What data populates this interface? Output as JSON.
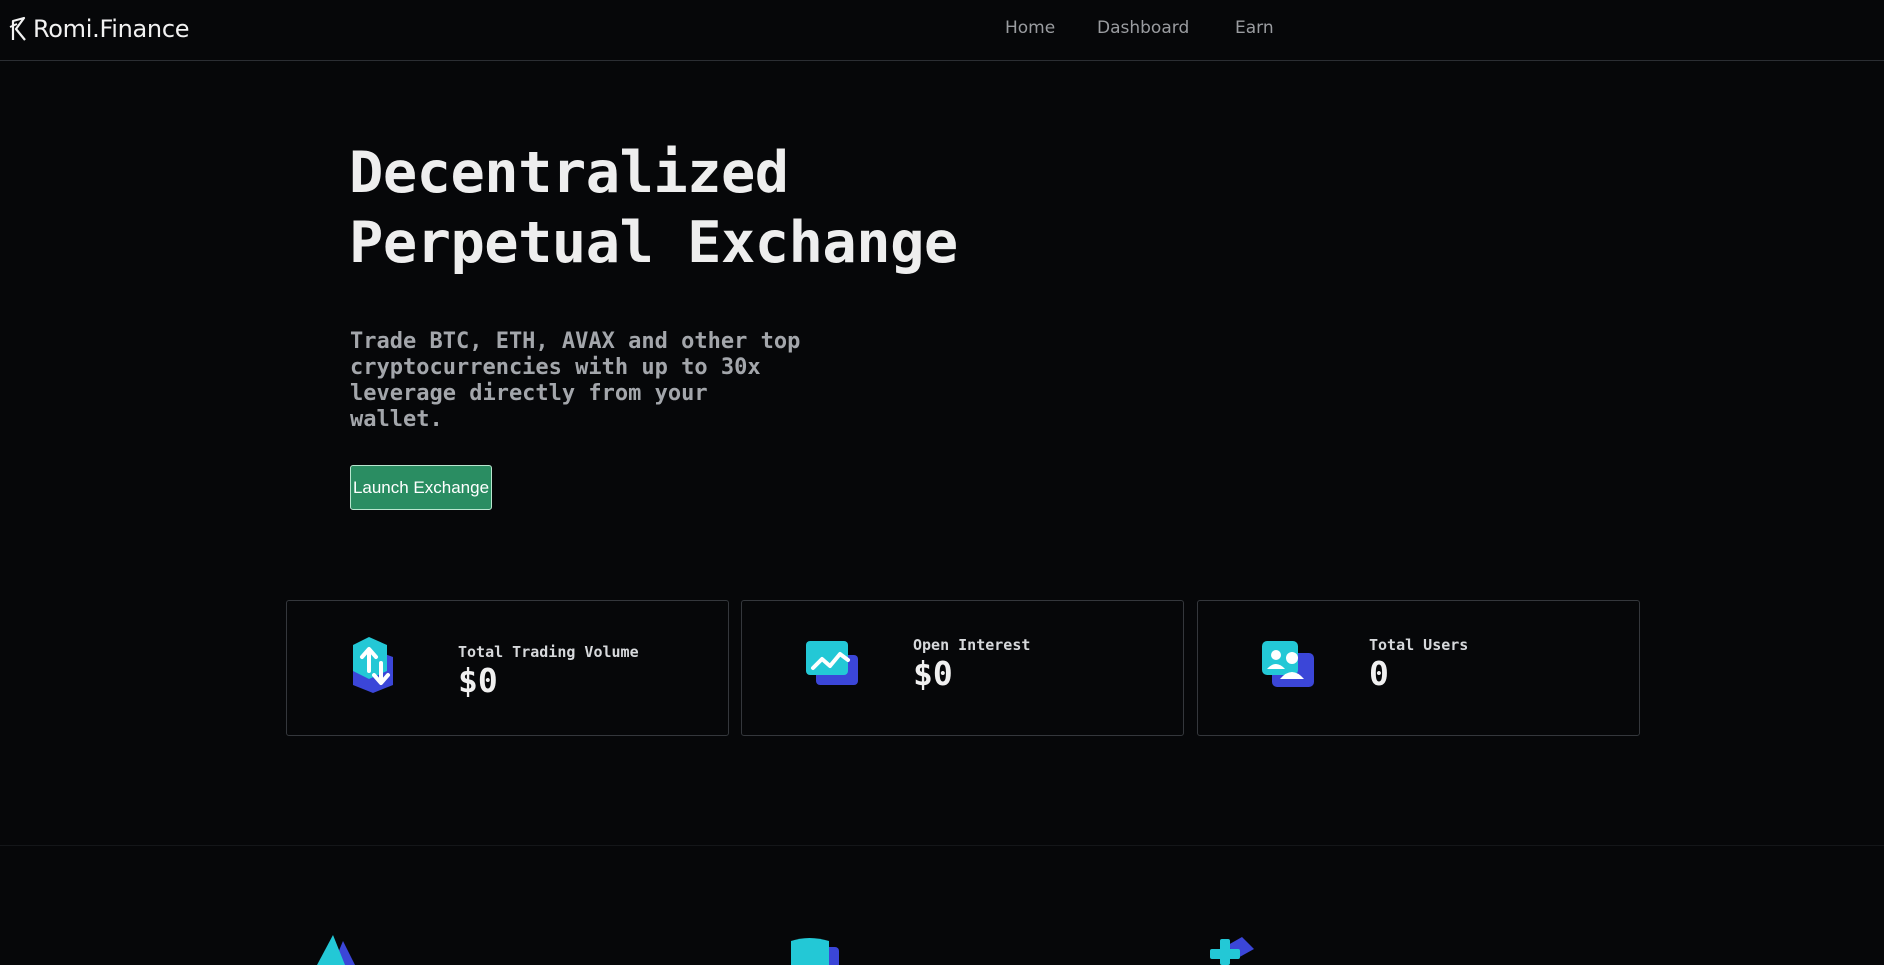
{
  "header": {
    "logo_text": "Romi.Finance",
    "nav": [
      {
        "label": "Home"
      },
      {
        "label": "Dashboard"
      },
      {
        "label": "Earn"
      }
    ]
  },
  "hero": {
    "title_line1": "Decentralized",
    "title_line2": "Perpetual Exchange",
    "subtitle": "Trade BTC, ETH, AVAX and other top cryptocurrencies with up to 30x leverage directly from your wallet.",
    "cta_label": "Launch Exchange"
  },
  "stats": [
    {
      "label": "Total Trading Volume",
      "value": "$0",
      "icon": "trading-volume-icon"
    },
    {
      "label": "Open Interest",
      "value": "$0",
      "icon": "open-interest-icon"
    },
    {
      "label": "Total Users",
      "value": "0",
      "icon": "users-icon"
    }
  ],
  "features": [
    {
      "icon": "drop-icon"
    },
    {
      "icon": "card-icon"
    },
    {
      "icon": "plus-icon"
    }
  ],
  "colors": {
    "background": "#060709",
    "accent_green": "#2a8d62",
    "icon_cyan": "#23c8d6",
    "icon_blue": "#3b46d8"
  }
}
